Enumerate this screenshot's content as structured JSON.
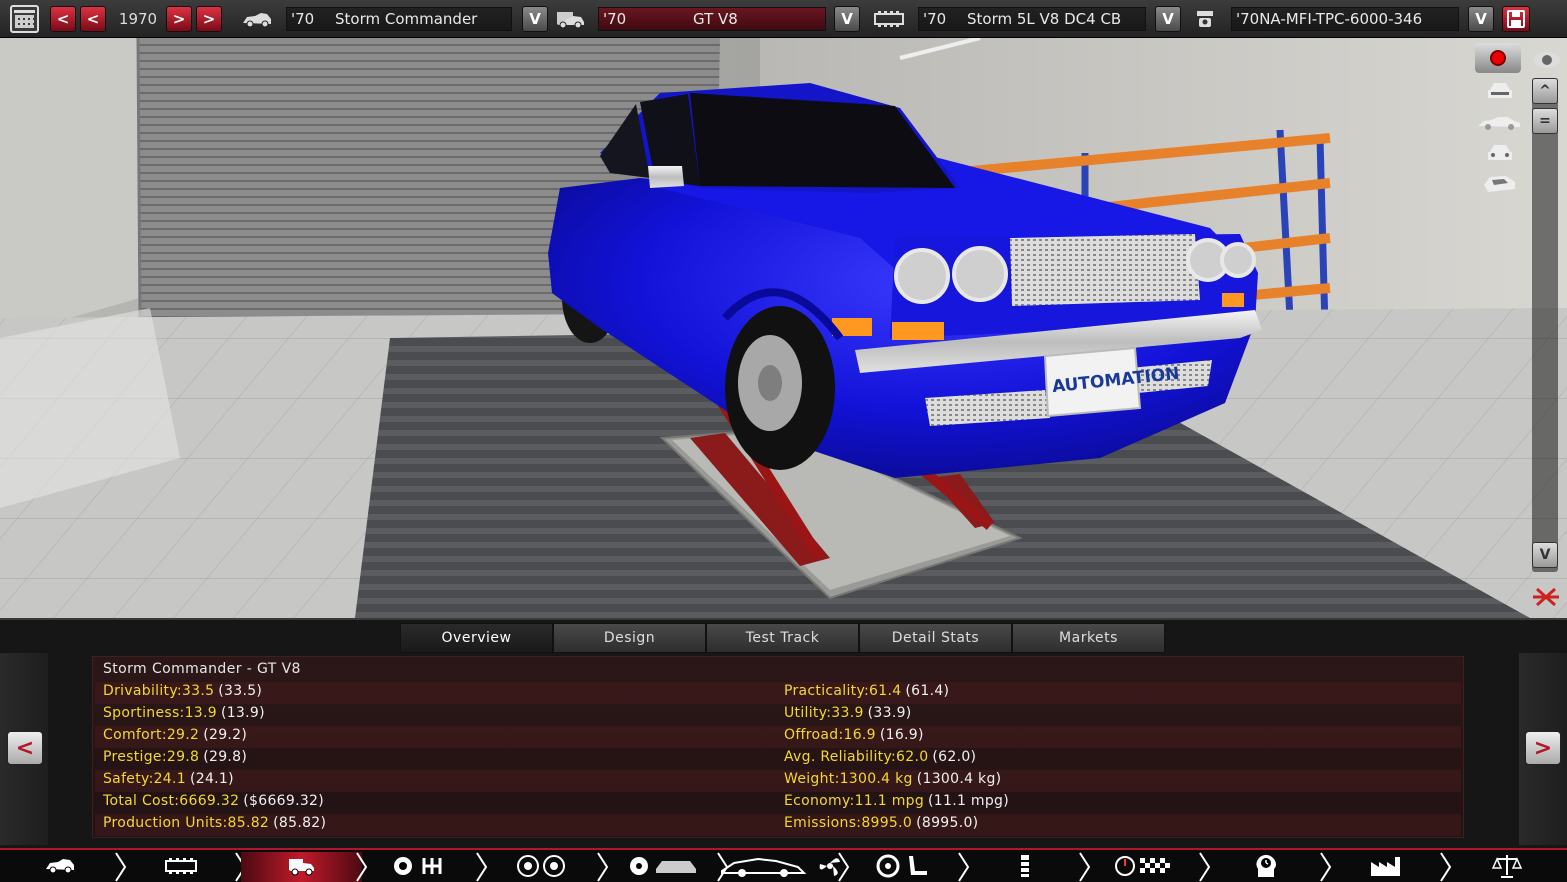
{
  "topbar": {
    "calendar_icon": "calendar-icon",
    "prev_fast": "<",
    "prev": "<",
    "year": "1970",
    "next": ">",
    "next_fast": ">",
    "model_year": "'70",
    "model_name": "Storm Commander",
    "trim_year": "'70",
    "trim_name": "GT V8",
    "engine_year": "'70",
    "engine_name": "Storm 5L V8 DC4 CB",
    "variant_name": "'70NA-MFI-TPC-6000-346",
    "dropdown_glyph": "V",
    "accent": "#b01828"
  },
  "viewport": {
    "license_plate": "AUTOMATION",
    "car_color": "#1010d8",
    "scroll_up": "^",
    "scroll_down": "V"
  },
  "tabs": [
    "Overview",
    "Design",
    "Test Track",
    "Detail Stats",
    "Markets"
  ],
  "active_tab": "Overview",
  "panel": {
    "nav_prev": "<",
    "nav_next": ">",
    "title": "Storm Commander - GT V8",
    "left_stats": [
      {
        "label": "Drivability:",
        "value": "33.5",
        "base": "(33.5)"
      },
      {
        "label": "Sportiness:",
        "value": "13.9",
        "base": "(13.9)"
      },
      {
        "label": "Comfort:",
        "value": "29.2",
        "base": "(29.2)"
      },
      {
        "label": "Prestige:",
        "value": "29.8",
        "base": "(29.8)"
      },
      {
        "label": "Safety:",
        "value": "24.1",
        "base": "(24.1)"
      },
      {
        "label": "Total Cost:",
        "value": "6669.32",
        "base": "($6669.32)"
      },
      {
        "label": "Production Units:",
        "value": "85.82",
        "base": "(85.82)"
      }
    ],
    "right_stats": [
      {
        "label": "Practicality:",
        "value": "61.4",
        "base": "(61.4)"
      },
      {
        "label": "Utility:",
        "value": "33.9",
        "base": "(33.9)"
      },
      {
        "label": "Offroad:",
        "value": "16.9",
        "base": "(16.9)"
      },
      {
        "label": "Avg. Reliability:",
        "value": "62.0",
        "base": "(62.0)"
      },
      {
        "label": "Weight:",
        "value": "1300.4 kg",
        "base": "(1300.4 kg)"
      },
      {
        "label": "Economy:",
        "value": "11.1 mpg",
        "base": "(11.1 mpg)"
      },
      {
        "label": "Emissions:",
        "value": "8995.0",
        "base": "(8995.0)"
      }
    ]
  },
  "bottom_nav": [
    {
      "icon": "car-side-icon",
      "active": false
    },
    {
      "icon": "chassis-icon",
      "active": false
    },
    {
      "icon": "car-van-icon",
      "active": true
    },
    {
      "icon": "suspension-gearbox-icon",
      "active": false
    },
    {
      "icon": "wheels-icon",
      "active": false
    },
    {
      "icon": "body-panels-icon",
      "active": false
    },
    {
      "icon": "car-body-fan-icon",
      "active": false
    },
    {
      "icon": "steering-seat-icon",
      "active": false
    },
    {
      "icon": "fuel-system-icon",
      "active": false
    },
    {
      "icon": "test-track-flag-icon",
      "active": false
    },
    {
      "icon": "engineering-time-icon",
      "active": false
    },
    {
      "icon": "factory-icon",
      "active": false
    },
    {
      "icon": "balance-scale-icon",
      "active": false
    }
  ]
}
